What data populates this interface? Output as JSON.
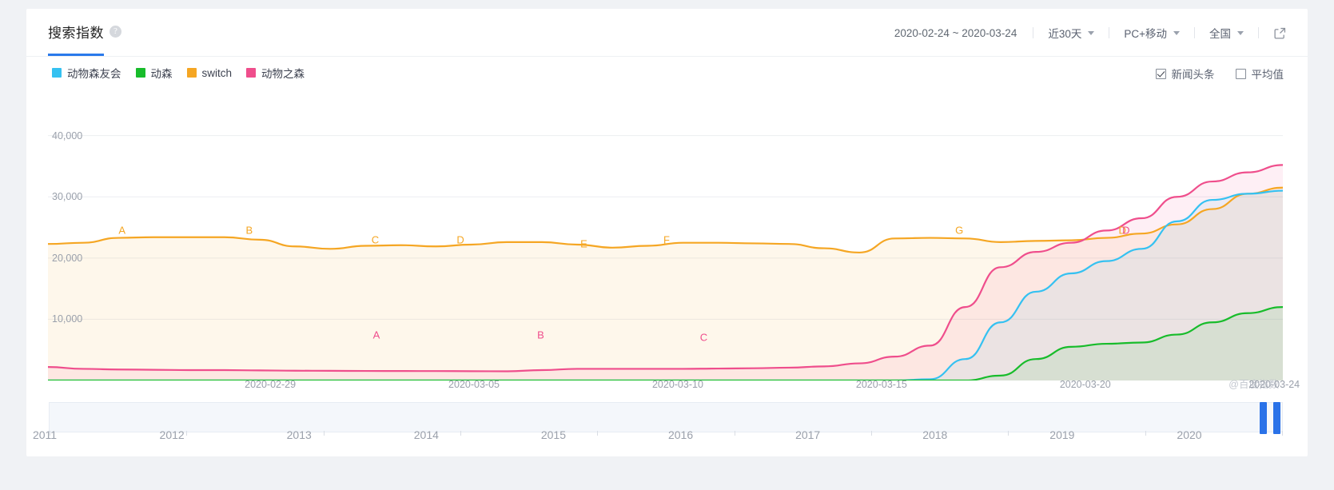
{
  "header": {
    "title": "搜索指数",
    "help_icon": "question-mark",
    "date_range": "2020-02-24 ~ 2020-03-24",
    "period": "近30天",
    "device": "PC+移动",
    "region": "全国",
    "external_link_icon": "external-link-icon"
  },
  "legend": [
    {
      "label": "动物森友会",
      "color": "#35c1f1"
    },
    {
      "label": "动森",
      "color": "#18bc2b"
    },
    {
      "label": "switch",
      "color": "#f5a623"
    },
    {
      "label": "动物之森",
      "color": "#ef4e8c"
    }
  ],
  "options": [
    {
      "label": "新闻头条",
      "checked": true
    },
    {
      "label": "平均值",
      "checked": false
    }
  ],
  "watermark": "@百度指数",
  "timeline": {
    "years": [
      "2011",
      "2012",
      "2013",
      "2014",
      "2015",
      "2016",
      "2017",
      "2018",
      "2019",
      "2020"
    ],
    "selection_start": "2020",
    "selection_end": "2020"
  },
  "chart_data": {
    "type": "line",
    "title": "搜索指数",
    "xlabel": "",
    "ylabel": "",
    "ylim": [
      0,
      44000
    ],
    "grid": true,
    "yticks": [
      40000,
      30000,
      20000,
      10000
    ],
    "ytick_labels": [
      "40,000",
      "30,000",
      "20,000",
      "10,000"
    ],
    "xtick_labels": [
      "2020-02-29",
      "2020-03-05",
      "2020-03-10",
      "2020-03-15",
      "2020-03-20",
      "2020-03-24"
    ],
    "x": [
      "2020-02-24",
      "2020-02-25",
      "2020-02-26",
      "2020-02-27",
      "2020-02-28",
      "2020-02-29",
      "2020-03-01",
      "2020-03-02",
      "2020-03-03",
      "2020-03-04",
      "2020-03-05",
      "2020-03-06",
      "2020-03-07",
      "2020-03-08",
      "2020-03-09",
      "2020-03-10",
      "2020-03-11",
      "2020-03-12",
      "2020-03-13",
      "2020-03-14",
      "2020-03-15",
      "2020-03-16",
      "2020-03-17",
      "2020-03-18",
      "2020-03-19",
      "2020-03-20",
      "2020-03-21",
      "2020-03-22",
      "2020-03-23",
      "2020-03-24"
    ],
    "series": [
      {
        "name": "switch",
        "color": "#f5a623",
        "values": [
          22300,
          22500,
          23300,
          23400,
          23400,
          23400,
          23000,
          21900,
          21500,
          22000,
          22100,
          21900,
          22200,
          22600,
          22600,
          22200,
          21700,
          22000,
          22500,
          22500,
          22400,
          22300,
          21600,
          20900,
          23200,
          23300,
          23200,
          22600,
          22800,
          22900,
          23300,
          24000,
          25500,
          28000,
          30500,
          31500
        ]
      },
      {
        "name": "动物之森",
        "color": "#ef4e8c",
        "values": [
          2200,
          1900,
          1800,
          1750,
          1700,
          1700,
          1650,
          1600,
          1580,
          1560,
          1550,
          1540,
          1520,
          1500,
          1700,
          1900,
          1900,
          1900,
          1900,
          1950,
          2000,
          2100,
          2300,
          2800,
          3900,
          5700,
          12000,
          18500,
          21000,
          22500,
          24500,
          26500,
          30000,
          32500,
          34000,
          35200
        ]
      },
      {
        "name": "动物森友会",
        "color": "#35c1f1",
        "values": [
          0,
          0,
          0,
          0,
          0,
          0,
          0,
          0,
          0,
          0,
          0,
          0,
          0,
          0,
          0,
          0,
          0,
          0,
          0,
          0,
          0,
          0,
          0,
          0,
          0,
          200,
          3500,
          9500,
          14500,
          17500,
          19500,
          21500,
          26000,
          29500,
          30500,
          31000
        ]
      },
      {
        "name": "动森",
        "color": "#18bc2b",
        "values": [
          0,
          0,
          0,
          0,
          0,
          0,
          0,
          0,
          0,
          0,
          0,
          0,
          0,
          0,
          0,
          0,
          0,
          0,
          0,
          0,
          0,
          0,
          0,
          0,
          0,
          0,
          0,
          800,
          3500,
          5500,
          6000,
          6200,
          7500,
          9500,
          11000,
          12000
        ]
      }
    ],
    "event_markers": [
      {
        "label": "A",
        "series": "switch",
        "x_pct": 6.0,
        "y": 24500,
        "color": "#f5a623"
      },
      {
        "label": "B",
        "series": "switch",
        "x_pct": 16.3,
        "y": 24500,
        "color": "#f5a623"
      },
      {
        "label": "C",
        "series": "switch",
        "x_pct": 26.5,
        "y": 23000,
        "color": "#f5a623"
      },
      {
        "label": "D",
        "series": "switch",
        "x_pct": 33.4,
        "y": 23000,
        "color": "#f5a623"
      },
      {
        "label": "E",
        "series": "switch",
        "x_pct": 43.4,
        "y": 22300,
        "color": "#f5a623"
      },
      {
        "label": "F",
        "series": "switch",
        "x_pct": 50.1,
        "y": 23000,
        "color": "#f5a623"
      },
      {
        "label": "G",
        "series": "switch",
        "x_pct": 73.8,
        "y": 24500,
        "color": "#f5a623"
      },
      {
        "label": "D",
        "series": "switch",
        "x_pct": 87.0,
        "y": 24500,
        "color": "#f5a623"
      },
      {
        "label": "A",
        "series": "动物之森",
        "x_pct": 26.6,
        "y": 7500,
        "color": "#ef4e8c"
      },
      {
        "label": "B",
        "series": "动物之森",
        "x_pct": 39.9,
        "y": 7500,
        "color": "#ef4e8c"
      },
      {
        "label": "C",
        "series": "动物之森",
        "x_pct": 53.1,
        "y": 7100,
        "color": "#ef4e8c"
      },
      {
        "label": "D",
        "series": "动物之森",
        "x_pct": 87.3,
        "y": 24500,
        "color": "#ef4e8c"
      }
    ]
  }
}
